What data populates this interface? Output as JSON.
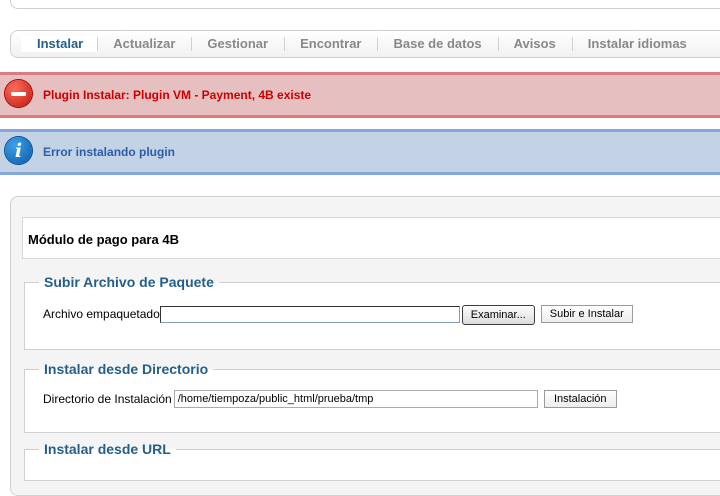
{
  "tabs": [
    {
      "label": "Instalar",
      "active": true
    },
    {
      "label": "Actualizar"
    },
    {
      "label": "Gestionar"
    },
    {
      "label": "Encontrar"
    },
    {
      "label": "Base de datos"
    },
    {
      "label": "Avisos"
    },
    {
      "label": "Instalar idiomas"
    }
  ],
  "messages": {
    "error": {
      "icon": "stop-icon",
      "text": "Plugin Instalar: Plugin VM - Payment, 4B existe"
    },
    "info": {
      "icon": "info-icon",
      "glyph": "i",
      "text": "Error instalando plugin"
    }
  },
  "module_title": "Módulo de pago para 4B",
  "upload": {
    "legend": "Subir Archivo de Paquete",
    "label": "Archivo empaquetado",
    "file_value": "",
    "browse_button": "Examinar...",
    "submit_button": "Subir e Instalar"
  },
  "directory": {
    "legend": "Instalar desde Directorio",
    "label": "Directorio de Instalación",
    "value": "/home/tiempoza/public_html/prueba/tmp",
    "button": "Instalación"
  },
  "url": {
    "legend": "Instalar desde URL"
  },
  "colors": {
    "error_bg": "#e6c0c0",
    "error_border": "#de7a7b",
    "error_text": "#cc0000",
    "info_bg": "#c3d2e5",
    "info_border": "#84a7db",
    "info_text": "#2a5ea8",
    "accent": "#245f8a"
  }
}
